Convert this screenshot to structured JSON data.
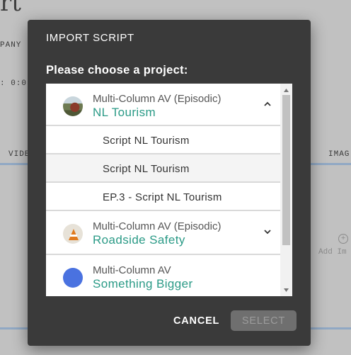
{
  "background": {
    "title_fragment": "rt",
    "company_fragment": "PANY :",
    "time_fragment": ": 0:0",
    "column_video_fragment": "VIDE",
    "column_image_fragment": "IMAG",
    "add_image_fragment": "Add Im"
  },
  "modal": {
    "title": "IMPORT SCRIPT",
    "prompt": "Please choose a project:",
    "projects": [
      {
        "type": "Multi-Column AV (Episodic)",
        "name": "NL Tourism",
        "expanded": true,
        "avatar_icon": "nl-tourism-thumbnail",
        "scripts": [
          "Script NL Tourism",
          "Script NL Tourism",
          "EP.3 - Script NL Tourism"
        ]
      },
      {
        "type": "Multi-Column AV (Episodic)",
        "name": "Roadside Safety",
        "expanded": false,
        "avatar_icon": "traffic-cone-thumbnail"
      },
      {
        "type": "Multi-Column AV",
        "name": "Something Bigger",
        "expanded": false,
        "avatar_icon": "blue-circle-avatar"
      }
    ],
    "cancel_label": "CANCEL",
    "select_label": "SELECT"
  },
  "colors": {
    "modal_bg": "#3a3a3a",
    "accent_teal": "#2a9a86",
    "avatar_blue": "#4a72e0",
    "disabled_button": "#6f6f6f"
  }
}
